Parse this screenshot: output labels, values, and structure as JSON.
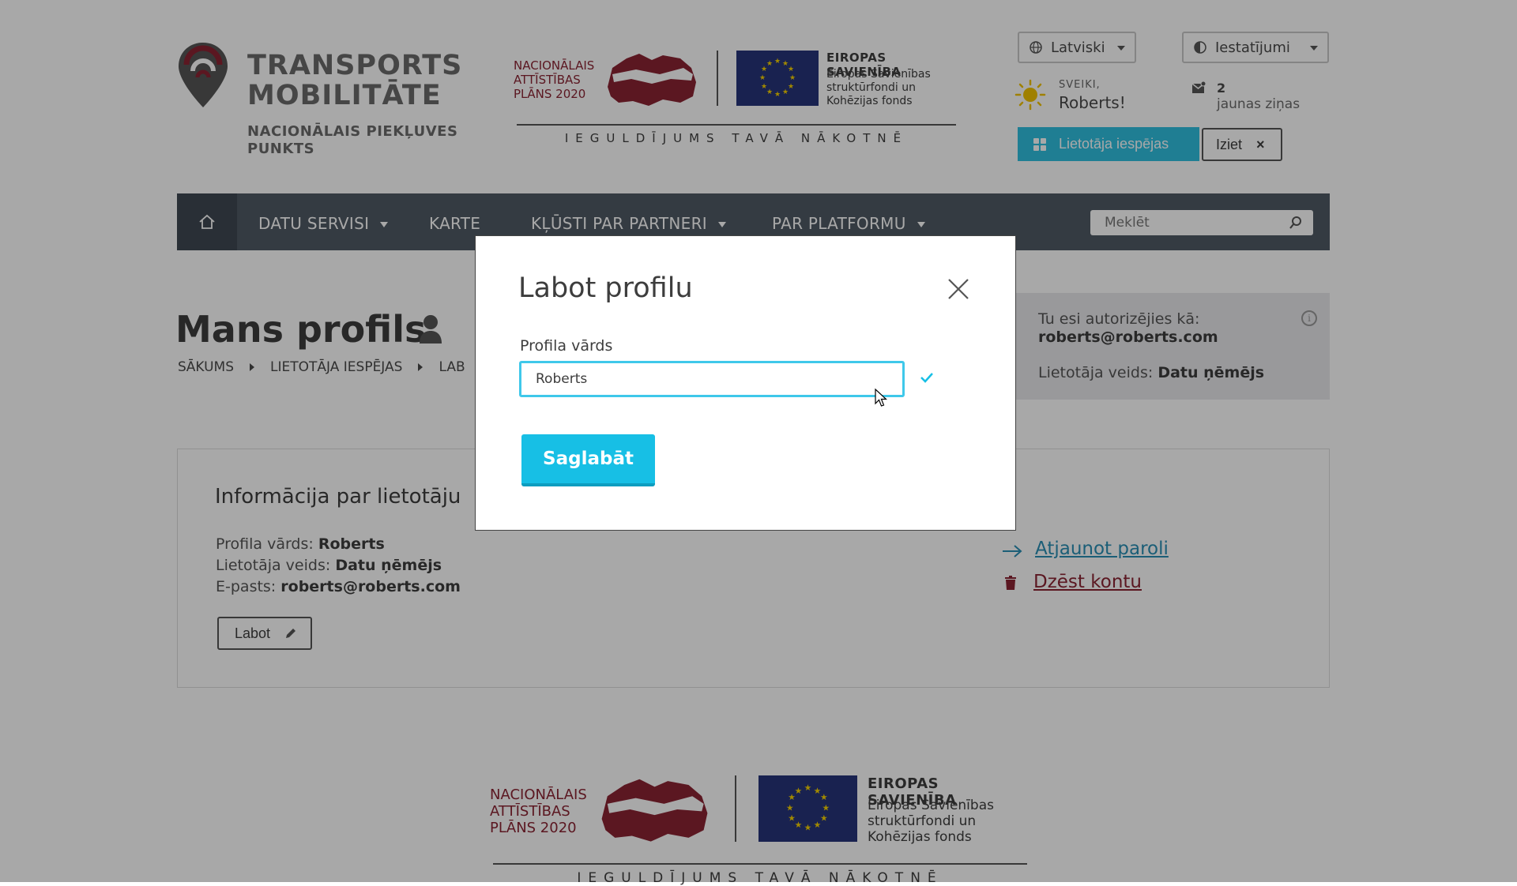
{
  "header": {
    "logo_title_1": "TRANSPORTS",
    "logo_title_2": "MOBILITĀTE",
    "logo_sub_1": "NACIONĀLAIS PIEKĻUVES",
    "logo_sub_2": "PUNKTS",
    "language": "Latviski",
    "settings": "Iestatījumi",
    "greeting_small": "SVEIKI,",
    "greeting_name": "Roberts!",
    "message_count": "2",
    "message_text": "jaunas ziņas",
    "user_options_label": "Lietotāja iespējas",
    "logout_label": "Iziet"
  },
  "fund_banner": {
    "nap_line1": "NACIONĀLAIS",
    "nap_line2": "ATTĪSTĪBAS",
    "nap_line3": "PLĀNS 2020",
    "eu_title": "EIROPAS SAVIENĪBA",
    "eu_sub1": "Eiropas Savienības",
    "eu_sub2": "struktūrfondi un",
    "eu_sub3": "Kohēzijas fonds",
    "motto": "IEGULDĪJUMS TAVĀ NĀKOTNĒ"
  },
  "nav": {
    "items": [
      {
        "label": "DATU SERVISI",
        "dropdown": true
      },
      {
        "label": "KARTE",
        "dropdown": false
      },
      {
        "label": "KĻŪSTI PAR PARTNERI",
        "dropdown": true
      },
      {
        "label": "PAR PLATFORMU",
        "dropdown": true
      }
    ],
    "search_placeholder": "Meklēt"
  },
  "page": {
    "title": "Mans profils",
    "breadcrumb": [
      "SĀKUMS",
      "LIETOTĀJA IESPĒJAS",
      "LAB"
    ]
  },
  "auth_panel": {
    "line1": "Tu esi autorizējies kā:",
    "email": "roberts@roberts.com",
    "type_label": "Lietotāja veids:",
    "type_value": "Datu ņēmējs"
  },
  "info_card": {
    "heading": "Informācija par lietotāju",
    "profile_name_label": "Profila vārds:",
    "profile_name_value": "Roberts",
    "user_type_label": "Lietotāja veids:",
    "user_type_value": "Datu ņēmējs",
    "email_label": "E-pasts:",
    "email_value": "roberts@roberts.com",
    "edit_label": "Labot",
    "renew_password": "Atjaunot paroli",
    "delete_account": "Dzēst kontu"
  },
  "modal": {
    "title": "Labot profilu",
    "field_label": "Profila vārds",
    "field_value": "Roberts",
    "save_label": "Saglabāt"
  },
  "colors": {
    "accent": "#17bfe5",
    "nav_bg": "#505a64",
    "brand_red": "#8a2433",
    "eu_blue": "#27347a"
  }
}
